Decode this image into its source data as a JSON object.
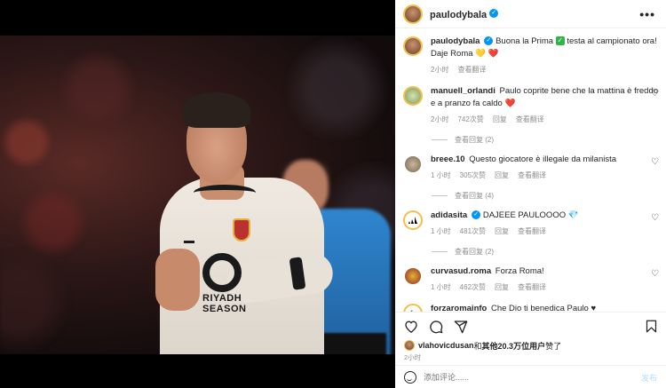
{
  "post": {
    "author": "paulodybala",
    "caption": "Buona la Prima ✅ testa al campionato ora! Daje Roma 💛❤️",
    "caption_text": "Buona la Prima",
    "caption_rest": "testa al campionato ora! Daje Roma",
    "caption_emoji": "💛 ❤️",
    "time": "2小时",
    "see_translation": "查看翻译",
    "more": "•••"
  },
  "comments": [
    {
      "user": "manuell_orlandi",
      "text": "Paulo coprite bene che la mattina è freddo e a pranzo fa caldo",
      "emoji": "❤️",
      "time": "2小时",
      "likes": "742次赞",
      "reply": "回复",
      "translate": "查看翻译",
      "replies": "查看回复 (2)",
      "avatar_color": "#c7d9a0"
    },
    {
      "user": "breee.10",
      "text": "Questo giocatore è illegale da milanista",
      "emoji": "",
      "time": "1 小时",
      "likes": "305次赞",
      "reply": "回复",
      "translate": "查看翻译",
      "replies": "查看回复 (4)",
      "avatar_color": "#b8a892"
    },
    {
      "user": "adidasita",
      "text": "DAJEEE PAULOOOO",
      "emoji": "💎",
      "time": "1 小时",
      "likes": "481次赞",
      "reply": "回复",
      "translate": "查看翻译",
      "replies": "查看回复 (2)",
      "avatar_color": "#ffffff"
    },
    {
      "user": "curvasud.roma",
      "text": "Forza Roma!",
      "emoji": "",
      "time": "1 小时",
      "likes": "462次赞",
      "reply": "回复",
      "translate": "查看翻译",
      "replies": "",
      "avatar_color": "#8f2a1f"
    },
    {
      "user": "forzaromainfo",
      "text": "Che Dio ti benedica Paulo",
      "emoji": "♥",
      "time": "",
      "likes": "",
      "reply": "",
      "translate": "",
      "replies": "",
      "avatar_color": "#ffffff"
    }
  ],
  "liked_by": {
    "user": "vlahovicdusan",
    "text": "和其他20.3万位用户赞了",
    "others": "其他20.3万位用户",
    "conj": "和",
    "suffix": "赞了"
  },
  "posted_time": "2小时",
  "add_comment": {
    "placeholder": "添加评论......",
    "post_label": "发布"
  },
  "icons": {
    "like": "heart-icon",
    "comment": "comment-icon",
    "share": "share-icon",
    "save": "bookmark-icon",
    "emoji": "emoji-icon"
  },
  "colors": {
    "verified": "#0095f6",
    "muted": "#8e8e8e",
    "post_button": "#b2dffc"
  },
  "photo": {
    "sponsor": "RIYADH SEASON"
  }
}
